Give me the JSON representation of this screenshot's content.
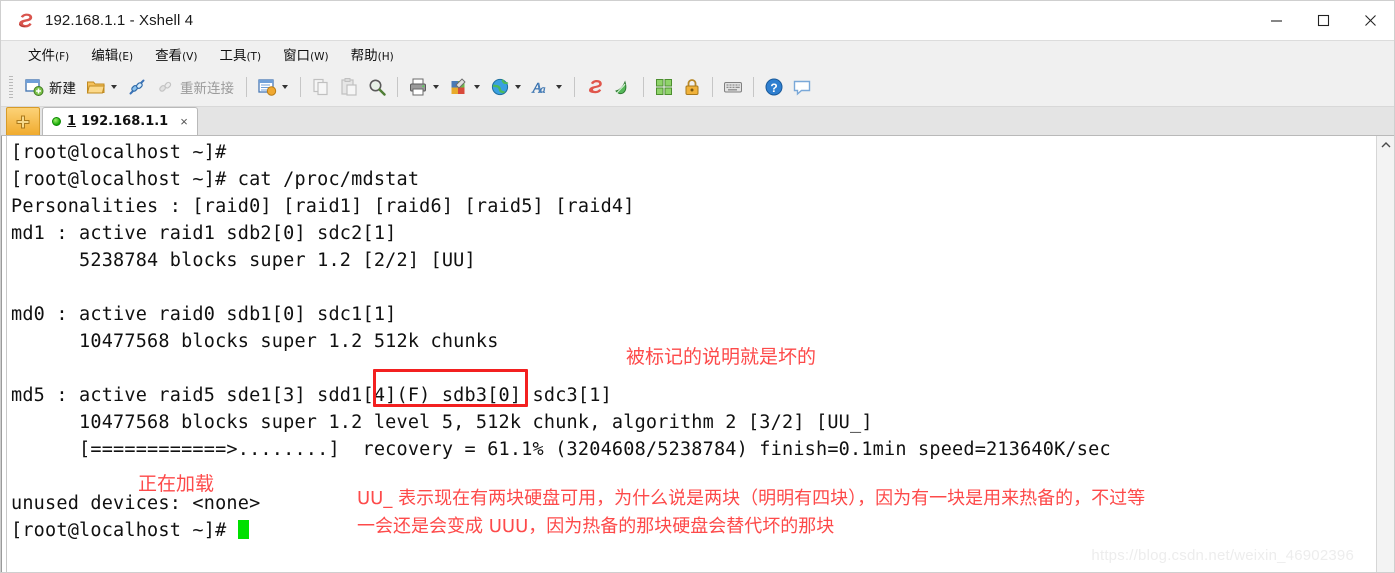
{
  "window": {
    "title": "192.168.1.1 - Xshell 4",
    "logo_icon": "xshell-logo-icon",
    "controls": [
      {
        "name": "minimize-button",
        "glyph": "minimize-icon"
      },
      {
        "name": "maximize-button",
        "glyph": "maximize-icon"
      },
      {
        "name": "close-button",
        "glyph": "close-icon"
      }
    ]
  },
  "menubar": {
    "items": [
      {
        "label": "文件",
        "mnemonic": "(F)"
      },
      {
        "label": "编辑",
        "mnemonic": "(E)"
      },
      {
        "label": "查看",
        "mnemonic": "(V)"
      },
      {
        "label": "工具",
        "mnemonic": "(T)"
      },
      {
        "label": "窗口",
        "mnemonic": "(W)"
      },
      {
        "label": "帮助",
        "mnemonic": "(H)"
      }
    ]
  },
  "toolbar": {
    "new_label": "新建",
    "reconnect_label": "重新连接",
    "icons": {
      "new": "new-session-icon",
      "open": "open-folder-icon",
      "connect": "connect-icon",
      "disconnect": "disconnect-icon",
      "properties": "session-properties-icon",
      "copy": "copy-icon",
      "paste": "paste-icon",
      "find": "search-icon",
      "print": "print-icon",
      "colors": "color-scheme-icon",
      "globe": "globe-icon",
      "font": "font-icon",
      "xshell": "xshell-icon",
      "xftp": "xftp-icon",
      "arrange": "arrange-windows-icon",
      "lock": "lock-icon",
      "keyboard": "keyboard-icon",
      "help": "help-icon",
      "chat": "chat-icon"
    }
  },
  "tabbar": {
    "new_tab_label": "+",
    "tabs": [
      {
        "index": "1",
        "title": "192.168.1.1",
        "status": "connected",
        "close_label": "×"
      }
    ]
  },
  "terminal": {
    "lines": [
      "[root@localhost ~]#",
      "[root@localhost ~]# cat /proc/mdstat",
      "Personalities : [raid0] [raid1] [raid6] [raid5] [raid4]",
      "md1 : active raid1 sdb2[0] sdc2[1]",
      "      5238784 blocks super 1.2 [2/2] [UU]",
      "",
      "md0 : active raid0 sdb1[0] sdc1[1]",
      "      10477568 blocks super 1.2 512k chunks",
      "",
      "md5 : active raid5 sde1[3] sdd1[4](F) sdb3[0] sdc3[1]",
      "      10477568 blocks super 1.2 level 5, 512k chunk, algorithm 2 [3/2] [UU_]",
      "      [============>........]  recovery = 61.1% (3204608/5238784) finish=0.1min speed=213640K/sec",
      "",
      "unused devices: <none>",
      "[root@localhost ~]# "
    ],
    "cursor": "block-cursor"
  },
  "annotations": [
    {
      "name": "annotation-failed-disk",
      "text": "被标记的说明就是坏的"
    },
    {
      "name": "annotation-loading",
      "text": "正在加载"
    },
    {
      "name": "annotation-uu-line1",
      "text": "UU_ 表示现在有两块硬盘可用，为什么说是两块（明明有四块），因为有一块是用来热备的，不过等"
    },
    {
      "name": "annotation-uu-line2",
      "text": "一会还是会变成 UUU，因为热备的那块硬盘会替代坏的那块"
    }
  ],
  "highlight_box": {
    "name": "failed-disk-highlight-box",
    "target": "sdd1[4](F)",
    "color": "#f32020"
  },
  "watermark": {
    "text": "https://blog.csdn.net/weixin_46902396"
  },
  "colors": {
    "cursor": "#00e000",
    "annotation": "#fd4a4a",
    "box": "#f32020",
    "tab_active_dot": "#16a806"
  }
}
